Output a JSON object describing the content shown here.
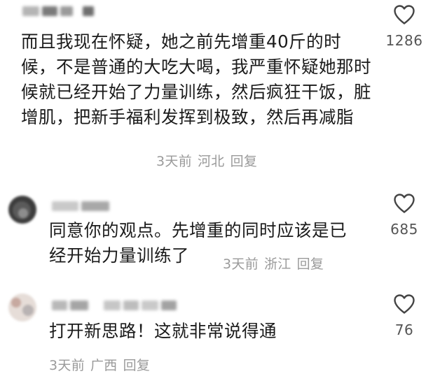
{
  "comments": [
    {
      "text": "而且我现在怀疑，她之前先增重40斤的时候，不是普通的大吃大喝，我严重怀疑她那时候就已经开始了力量训练，然后疯狂干饭，脏增肌，把新手福利发挥到极致，然后再减脂",
      "time": "3天前",
      "location": "河北",
      "reply_label": "回复",
      "likes": "1286",
      "icon": "heart-outline-icon"
    },
    {
      "text": "同意你的观点。先增重的同时应该是已经开始力量训练了",
      "time": "3天前",
      "location": "浙江",
      "reply_label": "回复",
      "likes": "685",
      "icon": "heart-outline-icon"
    },
    {
      "text": "打开新思路！这就非常说得通",
      "time": "3天前",
      "location": "广西",
      "reply_label": "回复",
      "likes": "76",
      "icon": "heart-outline-icon"
    }
  ]
}
